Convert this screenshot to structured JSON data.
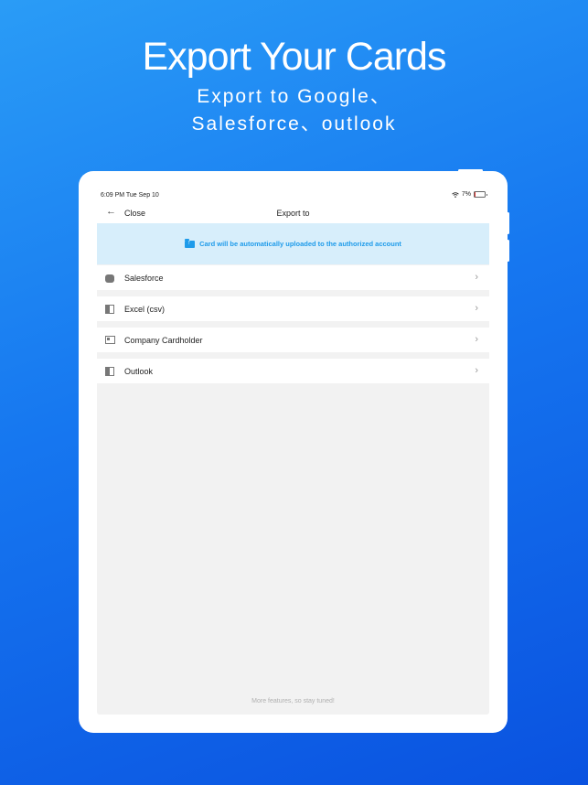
{
  "hero": {
    "title": "Export Your Cards",
    "subtitle_line1": "Export to Google、",
    "subtitle_line2": "Salesforce、outlook"
  },
  "statusbar": {
    "time": "6:09 PM  Tue Sep 10",
    "battery": "7%"
  },
  "navbar": {
    "back_icon": "←",
    "close_label": "Close",
    "title": "Export to"
  },
  "banner": {
    "text": "Card will be automatically uploaded to the authorized account",
    "icon": "folder-upload-icon"
  },
  "export_options": [
    {
      "label": "Salesforce",
      "icon": "salesforce-icon"
    },
    {
      "label": "Excel (csv)",
      "icon": "excel-icon"
    },
    {
      "label": "Company Cardholder",
      "icon": "company-card-icon"
    },
    {
      "label": "Outlook",
      "icon": "outlook-icon"
    }
  ],
  "chevron": "›",
  "footer_note": "More features, so stay tuned!",
  "colors": {
    "accent": "#1e9bea",
    "banner_bg": "#d7eefb",
    "background_top": "#2a9cf6",
    "background_bottom": "#0a52e0"
  }
}
